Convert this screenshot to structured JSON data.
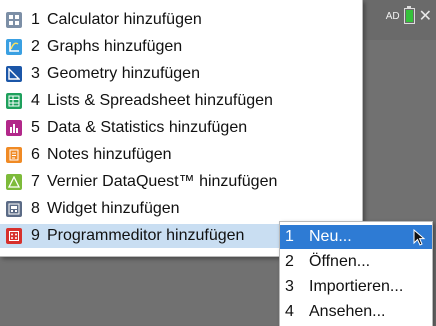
{
  "status": {
    "indicator": "AD"
  },
  "menu": {
    "items": [
      {
        "num": "1",
        "label": "Calculator hinzufügen",
        "icon": "calculator-icon",
        "color": "#7c8fa6"
      },
      {
        "num": "2",
        "label": "Graphs hinzufügen",
        "icon": "graphs-icon",
        "color": "#3aa0e2"
      },
      {
        "num": "3",
        "label": "Geometry hinzufügen",
        "icon": "geometry-icon",
        "color": "#1b56a8"
      },
      {
        "num": "4",
        "label": "Lists & Spreadsheet hinzufügen",
        "icon": "spreadsheet-icon",
        "color": "#1ea05c"
      },
      {
        "num": "5",
        "label": "Data & Statistics hinzufügen",
        "icon": "statistics-icon",
        "color": "#b2288a"
      },
      {
        "num": "6",
        "label": "Notes hinzufügen",
        "icon": "notes-icon",
        "color": "#f08a24"
      },
      {
        "num": "7",
        "label": "Vernier DataQuest™ hinzufügen",
        "icon": "dataquest-icon",
        "color": "#7dbb3a"
      },
      {
        "num": "8",
        "label": "Widget hinzufügen",
        "icon": "widget-icon",
        "color": "#5b6b86"
      },
      {
        "num": "9",
        "label": "Programmeditor hinzufügen",
        "icon": "program-editor-icon",
        "color": "#d7302c"
      }
    ]
  },
  "submenu": {
    "items": [
      {
        "num": "1",
        "label": "Neu..."
      },
      {
        "num": "2",
        "label": "Öffnen..."
      },
      {
        "num": "3",
        "label": "Importieren..."
      },
      {
        "num": "4",
        "label": "Ansehen..."
      }
    ]
  }
}
